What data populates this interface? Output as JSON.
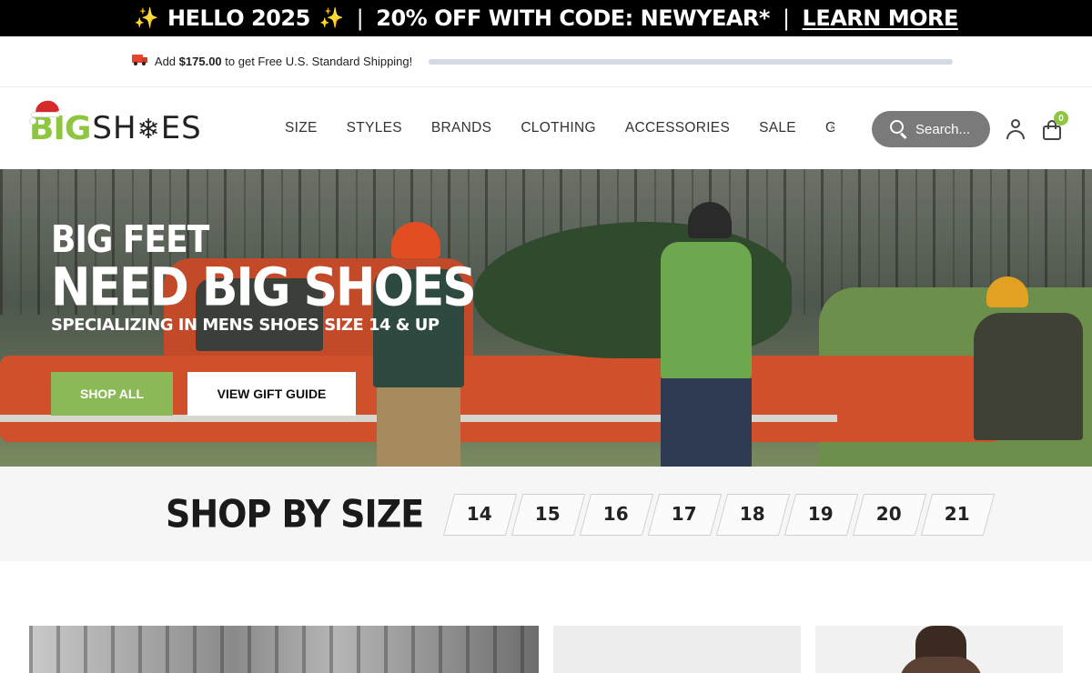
{
  "announcement": {
    "sparkle_left": "✨",
    "text_hello": "HELLO 2025",
    "sparkle_right": "✨",
    "sep": "|",
    "promo": "20% OFF WITH CODE: NEWYEAR*",
    "sep2": "|",
    "link": "LEARN MORE"
  },
  "shipping": {
    "prefix": "Add",
    "amount": "$175.00",
    "suffix": "to get Free U.S. Standard Shipping!",
    "progress_fraction": 0
  },
  "header": {
    "logo_big": "BIG",
    "logo_sh": "SH",
    "logo_flake": "❄",
    "logo_es": "ES",
    "nav": [
      "SIZE",
      "STYLES",
      "BRANDS",
      "CLOTHING",
      "ACCESSORIES",
      "SALE",
      "GIF"
    ],
    "nav_arrow": "›",
    "search_label": "Search...",
    "cart_count": "0"
  },
  "hero": {
    "line1": "BIG FEET",
    "line2": "NEED BIG SHOES",
    "line3": "SPECIALIZING IN MENS SHOES SIZE 14 & UP",
    "shop_all": "SHOP ALL",
    "gift_guide": "VIEW GIFT GUIDE"
  },
  "size_section": {
    "title": "SHOP BY SIZE",
    "sizes": [
      "14",
      "15",
      "16",
      "17",
      "18",
      "19",
      "20",
      "21"
    ]
  },
  "colors": {
    "brand_green": "#8dc63f",
    "button_green": "#8cb957",
    "announce_bg": "#000000",
    "search_bg": "#7a7a7a"
  }
}
